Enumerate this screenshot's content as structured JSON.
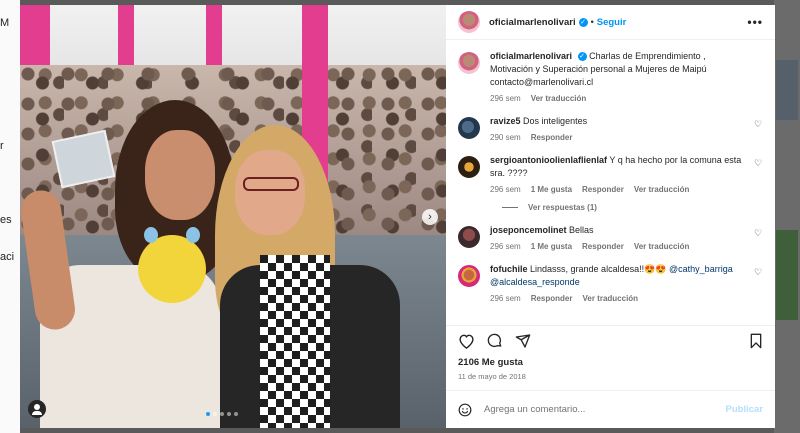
{
  "background": {
    "letters": [
      "M",
      "r",
      "es",
      "aci"
    ]
  },
  "post": {
    "username": "oficialmarlenolivari",
    "follow_label": "Seguir",
    "separator": "•",
    "more_label": "•••",
    "caption": {
      "text": "Charlas de Emprendimiento , Motivación y Superación personal a Mujeres de Maipú contacto@marlenolivari.cl",
      "age": "296 sem",
      "translate_label": "Ver traducción"
    },
    "likes": "2106 Me gusta",
    "date": "11 de mayo de 2018"
  },
  "comments": [
    {
      "user": "ravize5",
      "text": "Dos inteligentes",
      "age": "290 sem",
      "reply": "Responder",
      "avatar": "ravize5-avatar"
    },
    {
      "user": "sergioantonioolienlaflienlaf",
      "text": "Y q ha hecho por la comuna esta sra. ????",
      "age": "296 sem",
      "likes": "1 Me gusta",
      "reply": "Responder",
      "translate": "Ver traducción",
      "view_replies": "Ver respuestas (1)"
    },
    {
      "user": "joseponcemolinet",
      "text": "Bellas",
      "age": "296 sem",
      "likes": "1 Me gusta",
      "reply": "Responder",
      "translate": "Ver traducción"
    },
    {
      "user": "fofuchile",
      "text": "Lindasss, grande alcaldesa!!😍😍",
      "mention1": "@cathy_barriga",
      "mention2": "@alcaldesa_responde",
      "age": "296 sem",
      "reply": "Responder",
      "translate": "Ver traducción"
    }
  ],
  "comment_box": {
    "placeholder": "Agrega un comentario...",
    "publish_label": "Publicar"
  },
  "icons": {
    "like": "heart-icon",
    "comment": "comment-icon",
    "share": "share-icon",
    "save": "bookmark-icon",
    "emoji": "emoji-icon",
    "next": "chevron-right-icon"
  },
  "colors": {
    "accent": "#0095f6",
    "verified": "#0095f6",
    "publish_disabled": "#b2dffc",
    "muted": "#737373",
    "text": "#262626"
  }
}
